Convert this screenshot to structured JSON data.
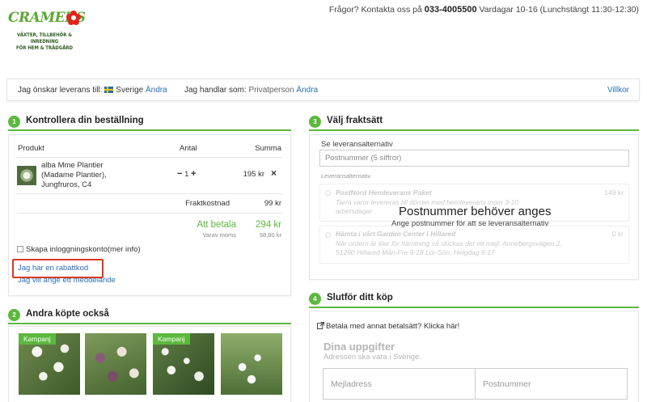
{
  "header": {
    "logo_wordmark_a": "CRAMERS",
    "logo_tagline_1": "VÄXTER, TILLBEHÖR & INREDNING",
    "logo_tagline_2": "FÖR HEM & TRÄDGÅRD",
    "contact_prefix": "Frågor? Kontakta oss på",
    "phone": "033-4005500",
    "hours": "Vardagar 10-16 (Lunchstängt 11:30-12:30)"
  },
  "delivery_bar": {
    "country_label": "Jag önskar leverans till:",
    "country": "Sverige",
    "country_change": "Ändra",
    "customer_label": "Jag handlar som:",
    "customer_type": "Privatperson",
    "customer_change": "Ändra",
    "terms": "Villkor"
  },
  "order": {
    "step": "1",
    "title": "Kontrollera din beställning",
    "col_product": "Produkt",
    "col_qty": "Antal",
    "col_sum": "Summa",
    "item": {
      "name_1": "alba Mme Plantier",
      "name_2": "(Madame Plantier),",
      "name_3": "Jungfruros, C4",
      "minus": "−",
      "qty": "1",
      "plus": "+",
      "price": "195 kr",
      "remove": "×"
    },
    "shipping_label": "Fraktkostnad",
    "shipping_value": "99 kr",
    "total_label": "Att betala",
    "total_value": "294 kr",
    "vat_label": "Varav moms",
    "vat_value": "58,80 kr",
    "create_account": "Skapa inloggningskonto",
    "more_info": "(mer info)",
    "discount_link": "Jag har en rabattkod",
    "message_link": "Jag vill ange ett meddelande"
  },
  "shipping": {
    "step": "3",
    "title": "Välj fraktsätt",
    "see_options": "Se leveransalternativ",
    "postcode_placeholder": "Postnummer (5 siffror)",
    "options_label": "Leveransalternativ",
    "opt1_name": "PostNord Hemleverans Paket",
    "opt1_price": "149 kr",
    "opt1_desc_1": "Tarra varor levereras till dörren med hemleverans inom 3-10",
    "opt1_desc_2": "arbetsdagar",
    "opt2_name": "Hämta i vårt Garden Center i Hillared",
    "opt2_price": "0 kr",
    "opt2_desc_1": "När ordern är klar för hämtning så skickas det ett mejl. Annebergsvägen 2,",
    "opt2_desc_2": "51290 Hillared Mån-Fre 9-18 Lör-Sön, Helgdag 9-17",
    "overlay_title": "Postnummer behöver anges",
    "overlay_sub": "Ange postnummer för att se leveransalternativ"
  },
  "others": {
    "step": "2",
    "title": "Andra köpte också",
    "badge": "Kampanj"
  },
  "checkout": {
    "step": "4",
    "title": "Slutför ditt köp",
    "other_payment": "Betala med annat betalsätt? Klicka här!",
    "details_title": "Dina uppgifter",
    "details_sub": "Adressen ska vara i Sverige.",
    "email_placeholder": "Mejladress",
    "postcode_placeholder": "Postnummer"
  },
  "colors": {
    "accent": "#5cb83e",
    "link": "#2a6fb3",
    "highlight": "#d9381e"
  }
}
